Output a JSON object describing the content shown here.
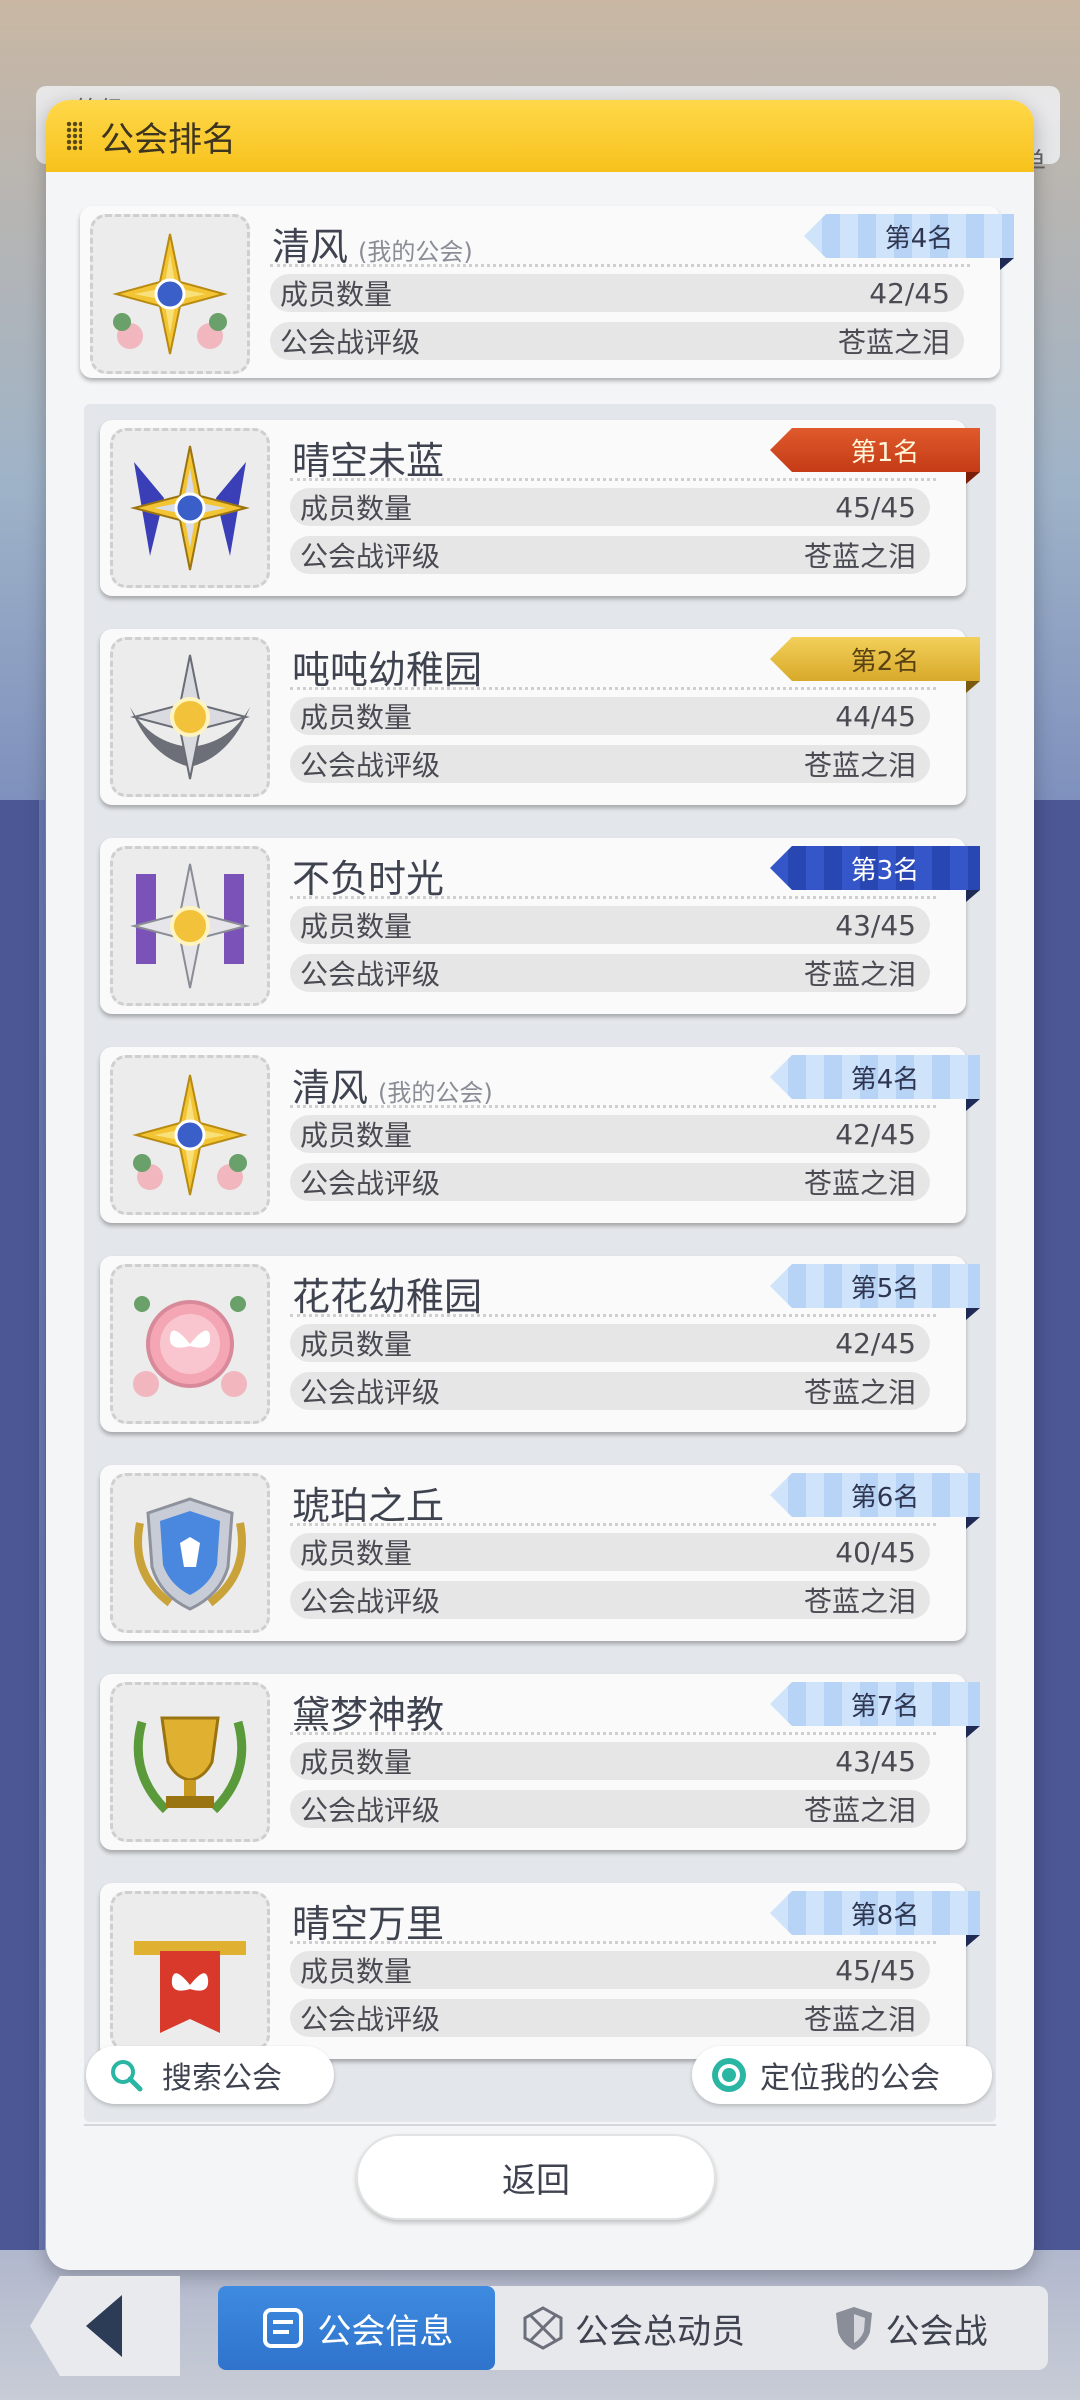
{
  "background": {
    "top_label": "等级",
    "side_label": "单"
  },
  "modal": {
    "title": "公会排名"
  },
  "my_guild": {
    "name": "清风",
    "tag": "(我的公会)",
    "rank": "第4名",
    "members_label": "成员数量",
    "members": "42/45",
    "rating_label": "公会战评级",
    "rating": "苍蓝之泪"
  },
  "rankings": [
    {
      "name": "晴空未蓝",
      "tag": "",
      "rank": "第1名",
      "ribbon": "red",
      "members_label": "成员数量",
      "members": "45/45",
      "rating_label": "公会战评级",
      "rating": "苍蓝之泪",
      "emblem": "blue-banner-star-emblem"
    },
    {
      "name": "吨吨幼稚园",
      "tag": "",
      "rank": "第2名",
      "ribbon": "gold",
      "members_label": "成员数量",
      "members": "44/45",
      "rating_label": "公会战评级",
      "rating": "苍蓝之泪",
      "emblem": "silver-wing-star-emblem"
    },
    {
      "name": "不负时光",
      "tag": "",
      "rank": "第3名",
      "ribbon": "navy",
      "members_label": "成员数量",
      "members": "43/45",
      "rating_label": "公会战评级",
      "rating": "苍蓝之泪",
      "emblem": "purple-banner-star-emblem"
    },
    {
      "name": "清风",
      "tag": "(我的公会)",
      "rank": "第4名",
      "ribbon": "blue",
      "members_label": "成员数量",
      "members": "42/45",
      "rating_label": "公会战评级",
      "rating": "苍蓝之泪",
      "emblem": "flower-star-emblem"
    },
    {
      "name": "花花幼稚园",
      "tag": "",
      "rank": "第5名",
      "ribbon": "blue",
      "members_label": "成员数量",
      "members": "42/45",
      "rating_label": "公会战评级",
      "rating": "苍蓝之泪",
      "emblem": "butterfly-seal-emblem"
    },
    {
      "name": "琥珀之丘",
      "tag": "",
      "rank": "第6名",
      "ribbon": "blue",
      "members_label": "成员数量",
      "members": "40/45",
      "rating_label": "公会战评级",
      "rating": "苍蓝之泪",
      "emblem": "deer-shield-emblem"
    },
    {
      "name": "黛梦神教",
      "tag": "",
      "rank": "第7名",
      "ribbon": "blue",
      "members_label": "成员数量",
      "members": "43/45",
      "rating_label": "公会战评级",
      "rating": "苍蓝之泪",
      "emblem": "trophy-laurel-emblem"
    },
    {
      "name": "晴空万里",
      "tag": "",
      "rank": "第8名",
      "ribbon": "blue",
      "members_label": "成员数量",
      "members": "45/45",
      "rating_label": "公会战评级",
      "rating": "苍蓝之泪",
      "emblem": "butterfly-banner-emblem"
    }
  ],
  "actions": {
    "search_label": "搜索公会",
    "locate_label": "定位我的公会",
    "back_label": "返回"
  },
  "bottom_nav": {
    "tabs": [
      {
        "label": "公会信息",
        "icon": "guild-info-icon",
        "active": true
      },
      {
        "label": "公会总动员",
        "icon": "guild-mobilize-icon",
        "active": false
      },
      {
        "label": "公会战",
        "icon": "shield-icon",
        "active": false
      }
    ]
  },
  "colors": {
    "header": "#f7c21c",
    "active_tab": "#2f73cc",
    "rank1": "#c43b16",
    "rank2": "#d8a92a",
    "rank3": "#2847b2",
    "rank_default": "#cfe3fb"
  }
}
